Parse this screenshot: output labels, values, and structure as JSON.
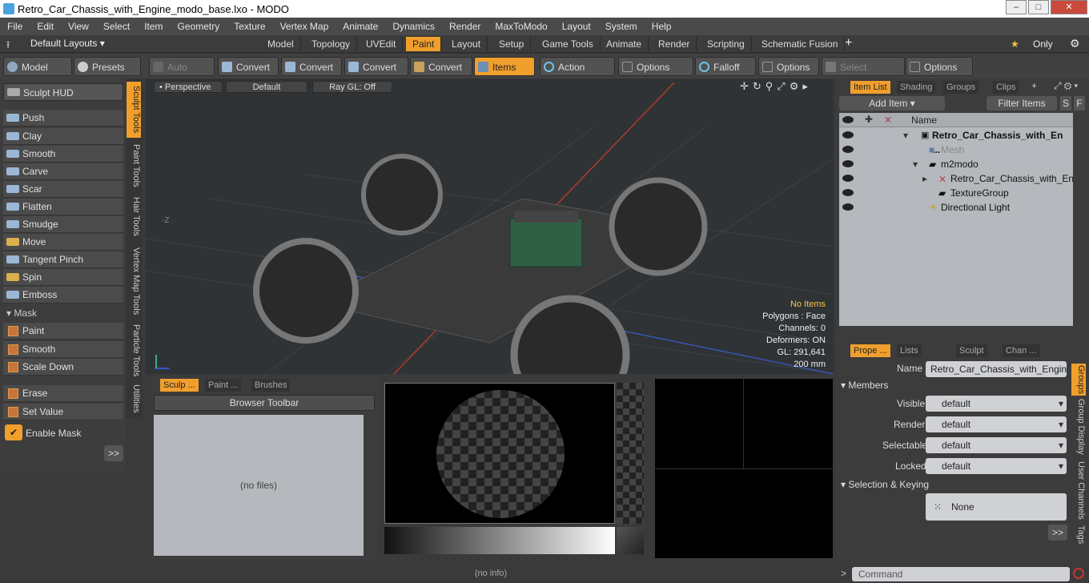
{
  "window": {
    "title": "Retro_Car_Chassis_with_Engine_modo_base.lxo - MODO",
    "min": "–",
    "max": "□",
    "close": "✕"
  },
  "menu": [
    "File",
    "Edit",
    "View",
    "Select",
    "Item",
    "Geometry",
    "Texture",
    "Vertex Map",
    "Animate",
    "Dynamics",
    "Render",
    "MaxToModo",
    "Layout",
    "System",
    "Help"
  ],
  "layout": {
    "default_layouts": "Default Layouts",
    "only": "Only"
  },
  "tabs": [
    "Model",
    "Topology",
    "UVEdit",
    "Paint",
    "Layout",
    "Setup",
    "Game Tools",
    "Animate",
    "Render",
    "Scripting",
    "Schematic Fusion"
  ],
  "active_tab": "Paint",
  "toolbar": {
    "model": "Model",
    "model_key": "F2",
    "presets": "Presets",
    "presets_key": "F6",
    "auto_select": "Auto Select",
    "convert": "Convert",
    "items": "Items",
    "action_center": "Action Center",
    "options": "Options",
    "falloff": "Falloff",
    "select_through": "Select Through"
  },
  "left": {
    "sculpt_hud": "Sculpt HUD",
    "tools": [
      "Push",
      "Clay",
      "Smooth",
      "Carve",
      "Scar",
      "Flatten",
      "Smudge",
      "Move",
      "Tangent Pinch",
      "Spin",
      "Emboss"
    ],
    "mask_header": "Mask",
    "mask_tools": [
      "Paint",
      "Smooth",
      "Scale Down"
    ],
    "other_tools": [
      "Erase",
      "Set Value"
    ],
    "enable_mask": "Enable Mask",
    "more": ">>"
  },
  "vtabs": [
    "Sculpt Tools",
    "Paint Tools",
    "Hair Tools",
    "Vertex Map Tools",
    "Particle Tools",
    "Utilities"
  ],
  "viewport": {
    "view": "Perspective",
    "shading": "Default",
    "ray": "Ray GL: Off",
    "no_items": "No Items",
    "polygons": "Polygons : Face",
    "channels": "Channels: 0",
    "deformers": "Deformers: ON",
    "gl": "GL: 291,641",
    "scale": "200 mm",
    "axis_z": "-Z"
  },
  "browser": {
    "tabs": [
      "Sculp ...",
      "Paint ...",
      "Brushes"
    ],
    "toolbar": "Browser Toolbar",
    "empty": "(no files)"
  },
  "itemlist": {
    "tabs": [
      "Item List",
      "Shading",
      "Groups",
      "Clips"
    ],
    "add_item": "Add Item",
    "filter": "Filter Items",
    "s": "S",
    "f": "F",
    "col_name": "Name",
    "rows": [
      {
        "label": "Retro_Car_Chassis_with_En ...",
        "bold": true
      },
      {
        "label": "Mesh",
        "dim": true
      },
      {
        "label": "m2modo"
      },
      {
        "label": "Retro_Car_Chassis_with_En ..."
      },
      {
        "label": "TextureGroup"
      },
      {
        "label": "Directional Light"
      }
    ]
  },
  "properties": {
    "tabs": [
      "Prope ...",
      "Lists",
      "Sculpt",
      "Chan ..."
    ],
    "name_label": "Name",
    "name_value": "Retro_Car_Chassis_with_Engine (",
    "members": "Members",
    "fields": [
      {
        "label": "Visible",
        "value": "default"
      },
      {
        "label": "Render",
        "value": "default"
      },
      {
        "label": "Selectable",
        "value": "default"
      },
      {
        "label": "Locked",
        "value": "default"
      }
    ],
    "sel_keying": "Selection & Keying",
    "none": "None",
    "more": ">>",
    "vtabs": [
      "Groups",
      "Group Display",
      "User Channels",
      "Tags"
    ]
  },
  "status": {
    "info": "(no info)",
    "command": "Command"
  }
}
